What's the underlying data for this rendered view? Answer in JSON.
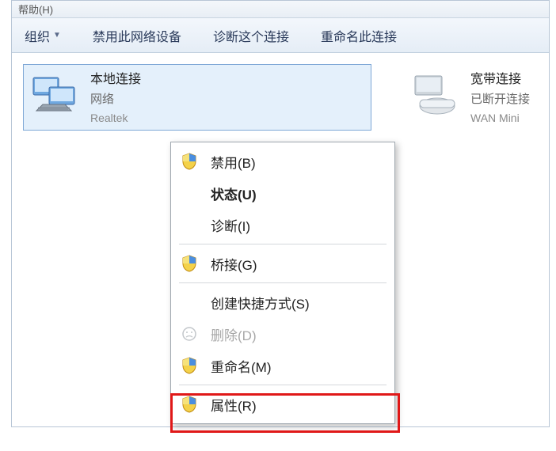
{
  "menubar": {
    "items": [
      "帮助(H)"
    ]
  },
  "toolbar": {
    "organize": "组织",
    "disable_device": "禁用此网络设备",
    "diagnose": "诊断这个连接",
    "rename": "重命名此连接"
  },
  "connections": {
    "local": {
      "title": "本地连接",
      "line2": "网络",
      "line3": "Realtek"
    },
    "broadband": {
      "title": "宽带连接",
      "line2": "已断开连接",
      "line3": "WAN Mini"
    }
  },
  "context_menu": {
    "disable": "禁用(B)",
    "status": "状态(U)",
    "diagnose": "诊断(I)",
    "bridge": "桥接(G)",
    "shortcut": "创建快捷方式(S)",
    "delete": "删除(D)",
    "rename": "重命名(M)",
    "properties": "属性(R)"
  },
  "icons": {
    "shield": "shield",
    "face_disabled": "face"
  }
}
